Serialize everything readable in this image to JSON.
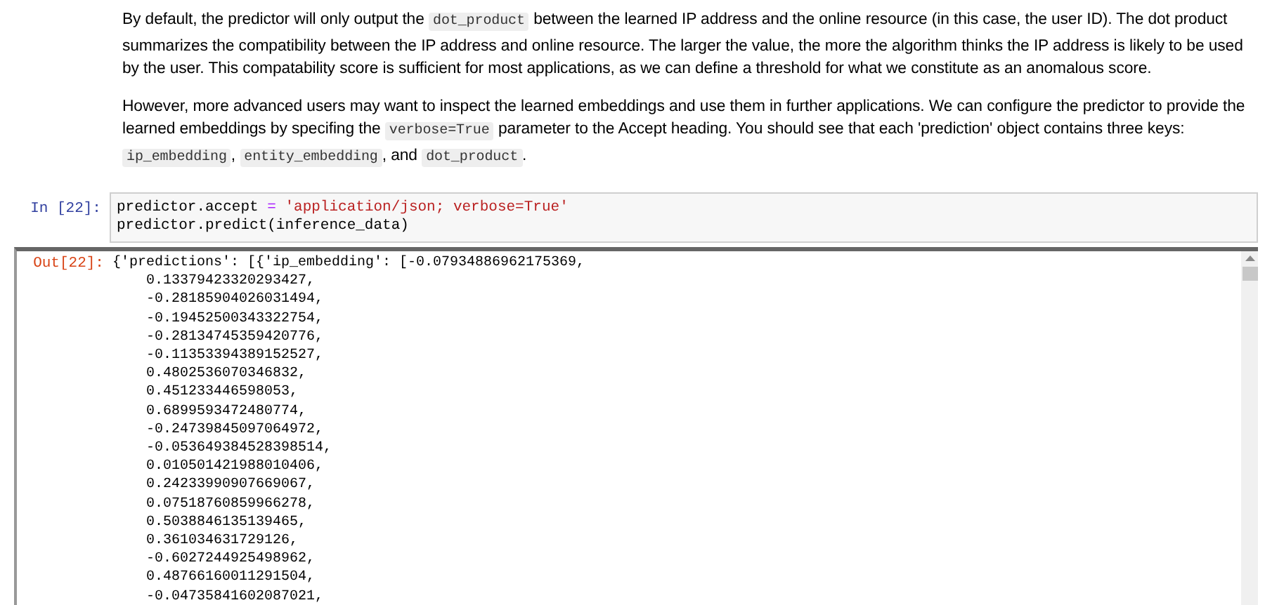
{
  "paragraphs": [
    {
      "segments": [
        {
          "kind": "text",
          "text": "By default, the predictor will only output the "
        },
        {
          "kind": "code",
          "text": "dot_product"
        },
        {
          "kind": "text",
          "text": " between the learned IP address and the online resource (in this case, the user ID). The dot product summarizes the compatibility between the IP address and online resource. The larger the value, the more the algorithm thinks the IP address is likely to be used by the user. This compatability score is sufficient for most applications, as we can define a threshold for what we constitute as an anomalous score."
        }
      ]
    },
    {
      "segments": [
        {
          "kind": "text",
          "text": "However, more advanced users may want to inspect the learned embeddings and use them in further applications. We can configure the predictor to provide the learned embeddings by specifing the "
        },
        {
          "kind": "code",
          "text": "verbose=True"
        },
        {
          "kind": "text",
          "text": " parameter to the Accept heading. You should see that each 'prediction' object contains three keys: "
        },
        {
          "kind": "code",
          "text": "ip_embedding"
        },
        {
          "kind": "text",
          "text": ", "
        },
        {
          "kind": "code",
          "text": "entity_embedding"
        },
        {
          "kind": "text",
          "text": ", and "
        },
        {
          "kind": "code",
          "text": "dot_product"
        },
        {
          "kind": "text",
          "text": "."
        }
      ]
    }
  ],
  "cell": {
    "in_prompt": "In [22]:",
    "code_lines": [
      [
        {
          "kind": "name",
          "text": "predictor.accept"
        },
        {
          "kind": "operator",
          "text": " = "
        },
        {
          "kind": "string",
          "text": "'application/json; verbose=True'"
        }
      ],
      [
        {
          "kind": "name",
          "text": "predictor.predict(inference_data)"
        }
      ]
    ],
    "out_prompt": "Out[22]:",
    "output_lines": [
      "{'predictions': [{'ip_embedding': [-0.07934886962175369,",
      "    0.13379423320293427,",
      "    -0.28185904026031494,",
      "    -0.19452500343322754,",
      "    -0.28134745359420776,",
      "    -0.11353394389152527,",
      "    0.4802536070346832,",
      "    0.451233446598053,",
      "    0.6899593472480774,",
      "    -0.24739845097064972,",
      "    -0.053649384528398514,",
      "    0.010501421988010406,",
      "    0.24233990907669067,",
      "    0.07518760859966278,",
      "    0.5038846135139465,",
      "    0.361034631729126,",
      "    -0.6027244925498962,",
      "    0.48766160011291504,",
      "    -0.04735841602087021,"
    ]
  }
}
